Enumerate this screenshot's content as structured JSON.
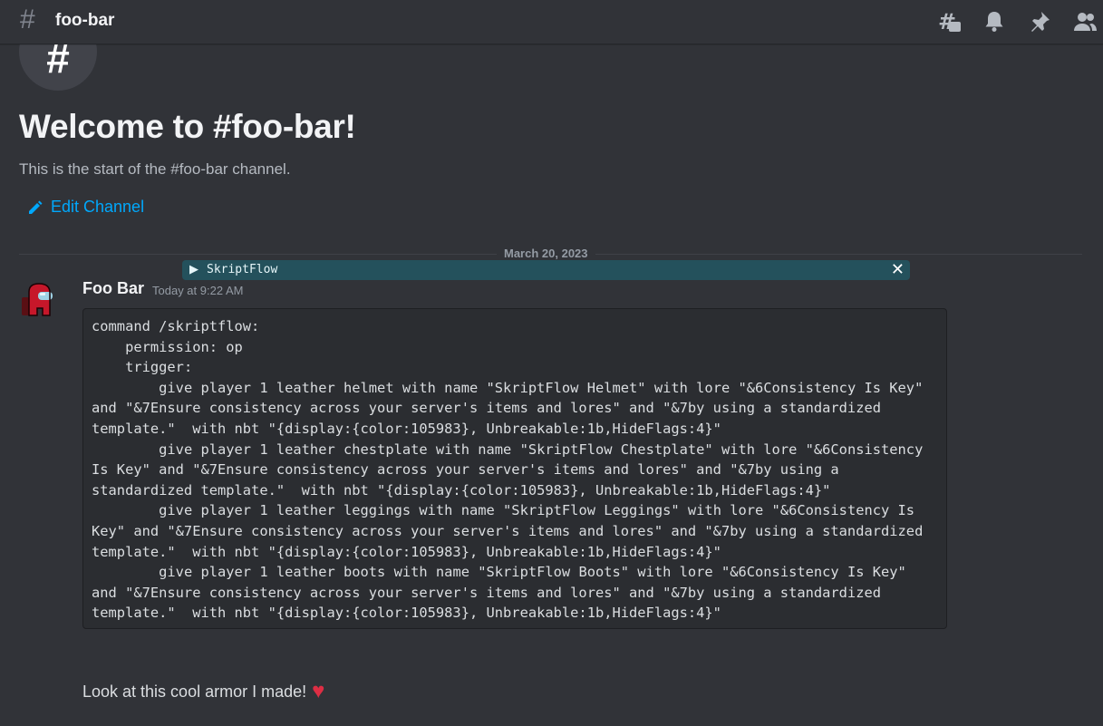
{
  "header": {
    "channel_name": "foo-bar",
    "icons": [
      "threads-icon",
      "bell-icon",
      "pin-icon",
      "members-icon"
    ]
  },
  "welcome": {
    "title": "Welcome to #foo-bar!",
    "subtitle": "This is the start of the #foo-bar channel.",
    "edit_channel_label": "Edit Channel"
  },
  "divider": {
    "date": "March 20, 2023"
  },
  "toast": {
    "label": "SkriptFlow"
  },
  "message": {
    "author": "Foo Bar",
    "timestamp": "Today at 9:22 AM",
    "code": "command /skriptflow:\n    permission: op\n    trigger:\n        give player 1 leather helmet with name \"SkriptFlow Helmet\" with lore \"&6Consistency Is Key\" and \"&7Ensure consistency across your server's items and lores\" and \"&7by using a standardized template.\"  with nbt \"{display:{color:105983}, Unbreakable:1b,HideFlags:4}\"\n        give player 1 leather chestplate with name \"SkriptFlow Chestplate\" with lore \"&6Consistency Is Key\" and \"&7Ensure consistency across your server's items and lores\" and \"&7by using a standardized template.\"  with nbt \"{display:{color:105983}, Unbreakable:1b,HideFlags:4}\"\n        give player 1 leather leggings with name \"SkriptFlow Leggings\" with lore \"&6Consistency Is Key\" and \"&7Ensure consistency across your server's items and lores\" and \"&7by using a standardized template.\"  with nbt \"{display:{color:105983}, Unbreakable:1b,HideFlags:4}\"\n        give player 1 leather boots with name \"SkriptFlow Boots\" with lore \"&6Consistency Is Key\" and \"&7Ensure consistency across your server's items and lores\" and \"&7by using a standardized template.\"  with nbt \"{display:{color:105983}, Unbreakable:1b,HideFlags:4}\"",
    "follow_up": "Look at this cool armor I made!"
  },
  "colors": {
    "background": "#313338",
    "link": "#00a8fc",
    "code_bg": "#2b2d31",
    "toast_bg": "#24515c",
    "heart": "#dd2e44"
  }
}
